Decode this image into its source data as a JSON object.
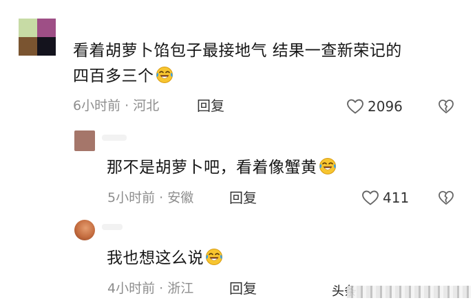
{
  "comments": [
    {
      "text_line1": "看着胡萝卜馅包子最接地气 结果一查新荣记的",
      "text_line2": "四百多三个",
      "time_location": "6小时前 · 河北",
      "reply_label": "回复",
      "like_count": "2096",
      "emoji": "laughing-tears-icon"
    },
    {
      "text": "那不是胡萝卜吧，看着像蟹黄",
      "time_location": "5小时前 · 安徽",
      "reply_label": "回复",
      "like_count": "411",
      "emoji": "laughing-tears-icon"
    },
    {
      "text": "我也想这么说",
      "time_location": "4小时前 · 浙江",
      "reply_label": "回复",
      "emoji": "laughing-tears-icon"
    }
  ],
  "icons": {
    "like": "heart-outline-icon",
    "dislike": "broken-heart-outline-icon"
  },
  "colors": {
    "text": "#161616",
    "meta": "#8d8d8d",
    "emoji_face": "#f7c530",
    "emoji_tear": "#3aa0e8"
  },
  "watermark": {
    "text": "头条"
  }
}
